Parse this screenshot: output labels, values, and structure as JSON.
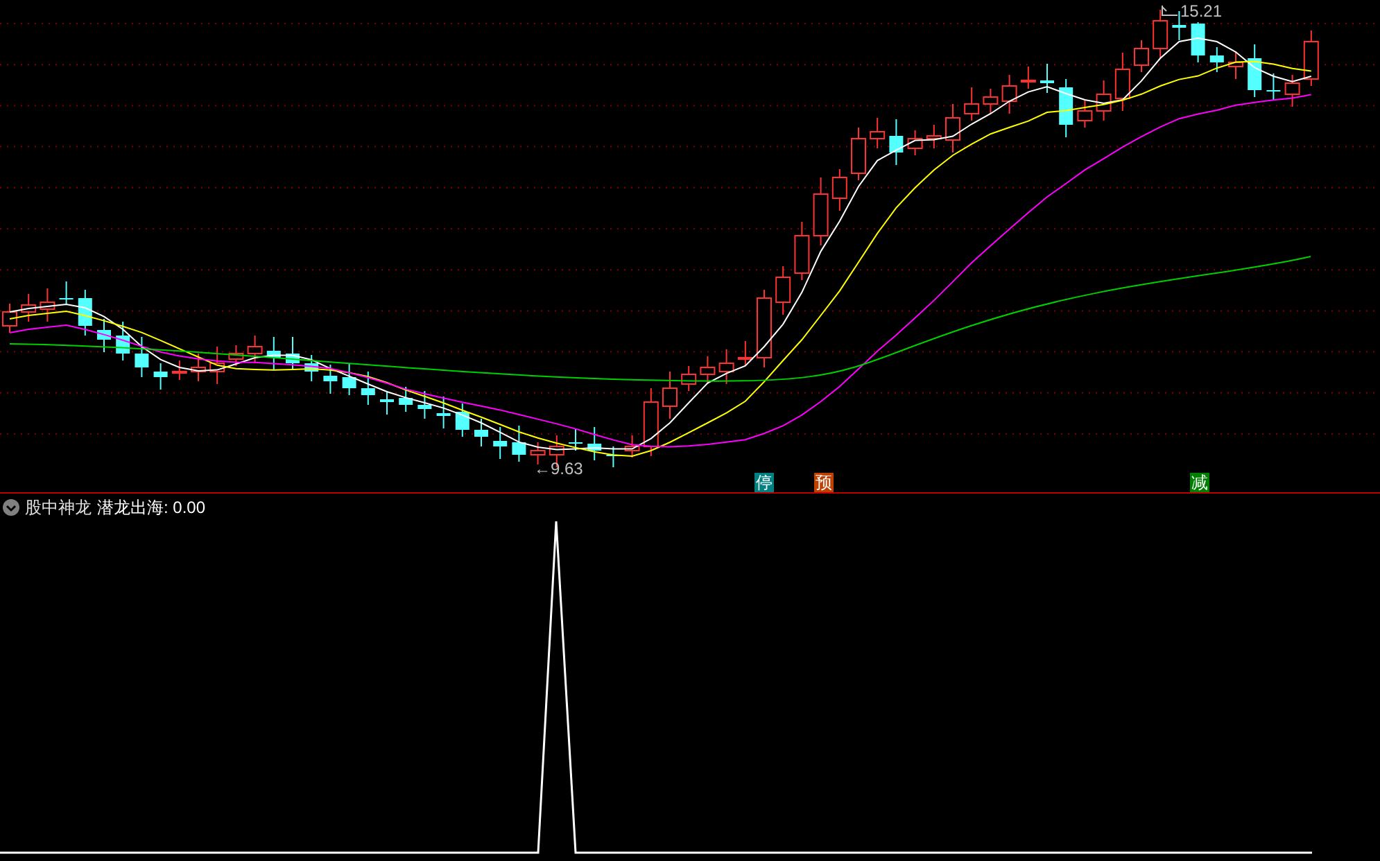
{
  "price_panel": {
    "high_label": "15.21",
    "low_label": "←9.63",
    "signals": [
      {
        "label": "停",
        "color": "#008080"
      },
      {
        "label": "预",
        "color": "#c04000"
      },
      {
        "label": "减",
        "color": "#008000"
      }
    ]
  },
  "indicator_panel": {
    "title": "股中神龙",
    "line_label": "潜龙出海: 0.00"
  }
}
